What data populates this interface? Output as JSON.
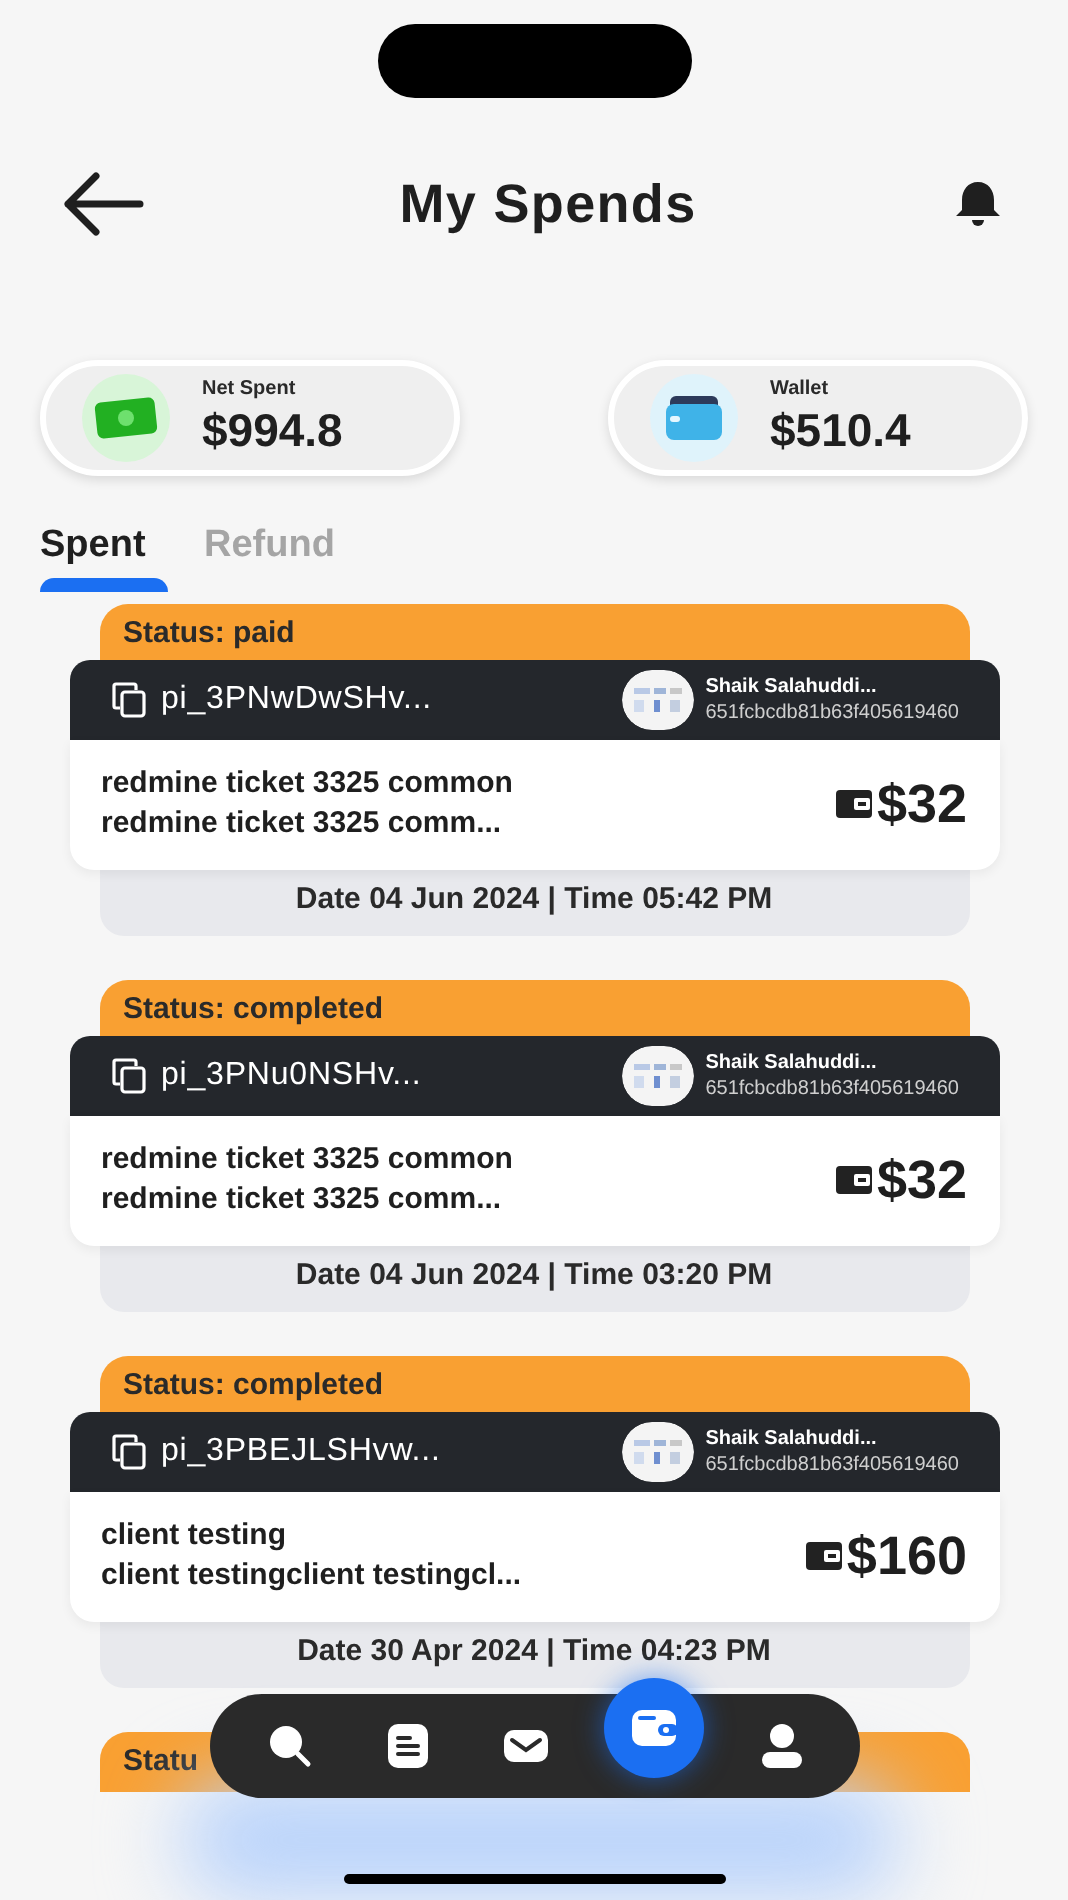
{
  "header": {
    "title": "My Spends"
  },
  "summary": [
    {
      "kind": "cash",
      "label": "Net Spent",
      "amount": "$994.8"
    },
    {
      "kind": "wallet",
      "label": "Wallet",
      "amount": "$510.4"
    }
  ],
  "tabs": [
    {
      "label": "Spent",
      "selected": true
    },
    {
      "label": "Refund",
      "selected": false
    }
  ],
  "transactions": [
    {
      "status": "Status: paid",
      "id": "pi_3PNwDwSHv...",
      "user_name": "Shaik Salahuddi...",
      "user_id": "651fcbcdb81b63f405619460",
      "line_1": "redmine ticket 3325 common",
      "line_2": "redmine ticket 3325 comm...",
      "amount": "$32",
      "datetime": "Date 04 Jun 2024 | Time 05:42 PM"
    },
    {
      "status": "Status: completed",
      "id": "pi_3PNu0NSHv...",
      "user_name": "Shaik Salahuddi...",
      "user_id": "651fcbcdb81b63f405619460",
      "line_1": "redmine ticket 3325 common",
      "line_2": "redmine ticket 3325 comm...",
      "amount": "$32",
      "datetime": "Date 04 Jun 2024 | Time 03:20 PM"
    },
    {
      "status": "Status: completed",
      "id": "pi_3PBEJLSHvw...",
      "user_name": "Shaik Salahuddi...",
      "user_id": "651fcbcdb81b63f405619460",
      "line_1": "client testing",
      "line_2": "client testingclient testingcl...",
      "amount": "$160",
      "datetime": "Date 30 Apr 2024 | Time 04:23 PM"
    }
  ],
  "partial_transaction": {
    "status": "Statu"
  },
  "nav": [
    {
      "kind": "search",
      "selected": false
    },
    {
      "kind": "list",
      "selected": false
    },
    {
      "kind": "mail",
      "selected": false
    },
    {
      "kind": "wallet",
      "selected": true
    },
    {
      "kind": "profile",
      "selected": false
    }
  ]
}
